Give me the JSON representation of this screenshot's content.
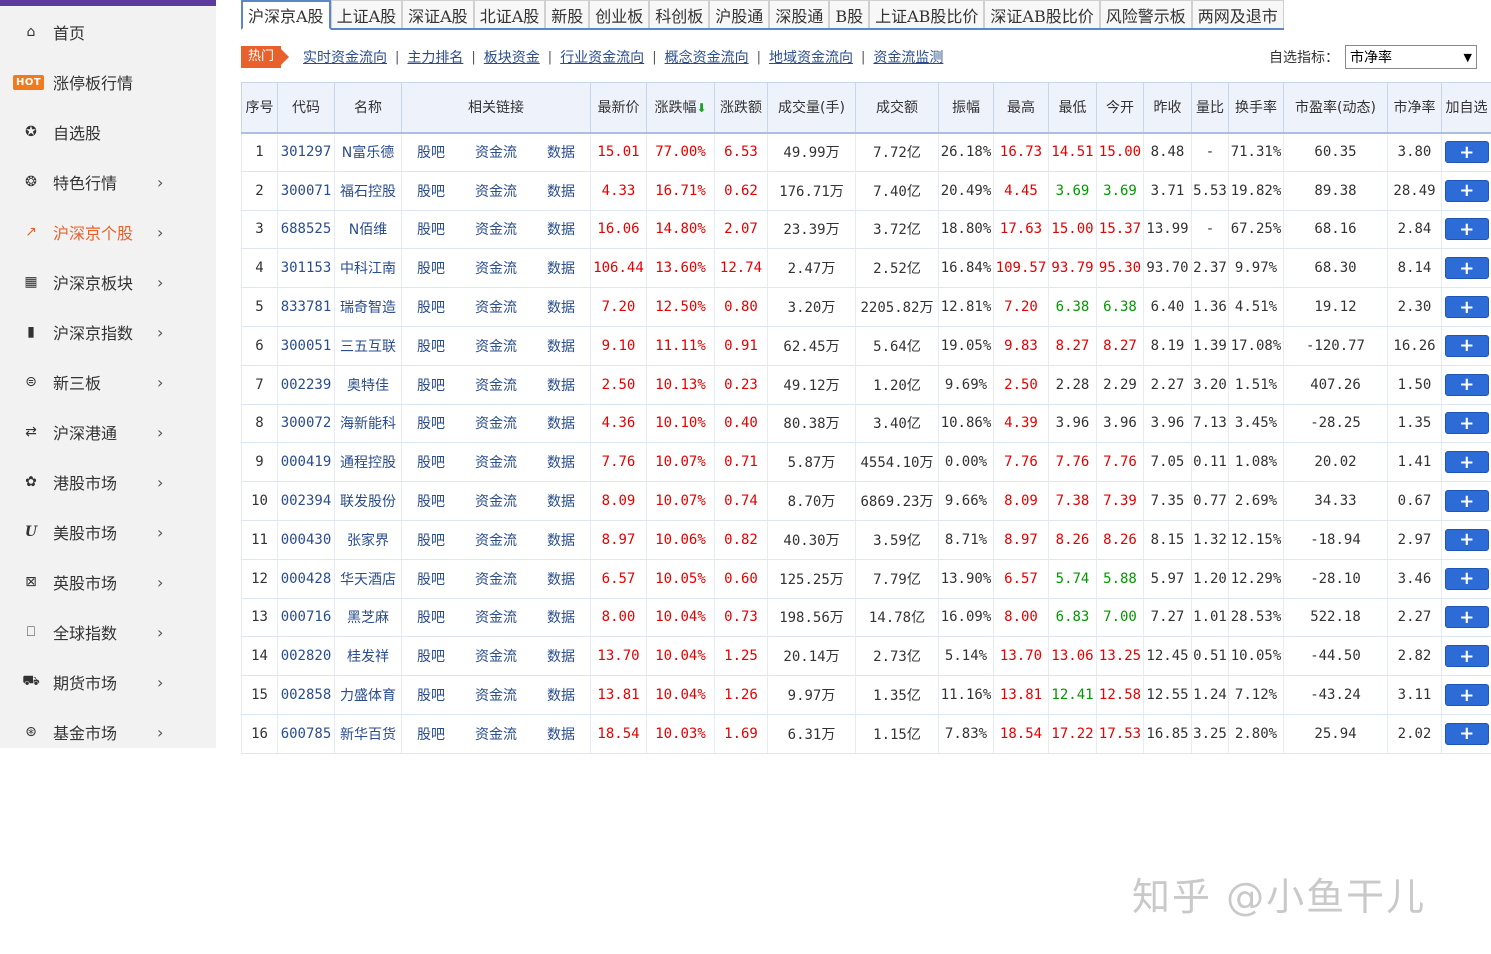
{
  "sidebar": {
    "items": [
      {
        "label": "首页",
        "icon": "home-icon",
        "glyph": "⌂",
        "chevron": false
      },
      {
        "label": "涨停板行情",
        "icon": "hot-icon",
        "glyph": "HOT",
        "chevron": false
      },
      {
        "label": "自选股",
        "icon": "star-circle-icon",
        "glyph": "✪",
        "chevron": false
      },
      {
        "label": "特色行情",
        "icon": "bulb-icon",
        "glyph": "❂",
        "chevron": true
      },
      {
        "label": "沪深京个股",
        "icon": "trend-circle-icon",
        "glyph": "↗",
        "chevron": true,
        "active": true
      },
      {
        "label": "沪深京板块",
        "icon": "grid-icon",
        "glyph": "▦",
        "chevron": true
      },
      {
        "label": "沪深京指数",
        "icon": "bar-chart-icon",
        "glyph": "▮",
        "chevron": true
      },
      {
        "label": "新三板",
        "icon": "list-circle-icon",
        "glyph": "⊜",
        "chevron": true
      },
      {
        "label": "沪深港通",
        "icon": "exchange-icon",
        "glyph": "⇄",
        "chevron": true
      },
      {
        "label": "港股市场",
        "icon": "bauhinia-icon",
        "glyph": "✿",
        "chevron": true
      },
      {
        "label": "美股市场",
        "icon": "u-letter-icon",
        "glyph": "U",
        "chevron": true
      },
      {
        "label": "英股市场",
        "icon": "uk-flag-icon",
        "glyph": "⊠",
        "chevron": true
      },
      {
        "label": "全球指数",
        "icon": "bookmark-icon",
        "glyph": "⎕",
        "chevron": true
      },
      {
        "label": "期货市场",
        "icon": "cart-icon",
        "glyph": "⛟",
        "chevron": true
      },
      {
        "label": "基金市场",
        "icon": "fund-icon",
        "glyph": "⊛",
        "chevron": true
      }
    ],
    "hot_badge": "HOT"
  },
  "tabs": [
    "沪深京A股",
    "上证A股",
    "深证A股",
    "北证A股",
    "新股",
    "创业板",
    "科创板",
    "沪股通",
    "深股通",
    "B股",
    "上证AB股比价",
    "深证AB股比价",
    "风险警示板",
    "两网及退市"
  ],
  "subnav": {
    "hot": "热门",
    "links": [
      "实时资金流向",
      "主力排名",
      "板块资金",
      "行业资金流向",
      "概念资金流向",
      "地域资金流向",
      "资金流监测"
    ],
    "separator": "|",
    "indicator_label": "自选指标：",
    "indicator_value": "市净率"
  },
  "table": {
    "headers": [
      "序号",
      "代码",
      "名称",
      "相关链接",
      "最新价",
      "涨跌幅",
      "涨跌额",
      "成交量(手)",
      "成交额",
      "振幅",
      "最高",
      "最低",
      "今开",
      "昨收",
      "量比",
      "换手率",
      "市盈率(动态)",
      "市净率",
      "加自选"
    ],
    "link_labels": [
      "股吧",
      "资金流",
      "数据"
    ],
    "add_label": "+",
    "sort_arrow": "⬇",
    "rows": [
      {
        "no": "1",
        "code": "301297",
        "name": "N富乐德",
        "price": "15.01",
        "chg_pct": "77.00%",
        "chg": "6.53",
        "vol": "49.99万",
        "amt": "7.72亿",
        "amp": "26.18%",
        "high": "16.73",
        "low": "14.51",
        "open": "15.00",
        "prev": "8.48",
        "vr": "-",
        "turn": "71.31%",
        "pe": "60.35",
        "pb": "3.80",
        "low_c": "red",
        "open_c": "red"
      },
      {
        "no": "2",
        "code": "300071",
        "name": "福石控股",
        "price": "4.33",
        "chg_pct": "16.71%",
        "chg": "0.62",
        "vol": "176.71万",
        "amt": "7.40亿",
        "amp": "20.49%",
        "high": "4.45",
        "low": "3.69",
        "open": "3.69",
        "prev": "3.71",
        "vr": "5.53",
        "turn": "19.82%",
        "pe": "89.38",
        "pb": "28.49",
        "low_c": "green",
        "open_c": "green"
      },
      {
        "no": "3",
        "code": "688525",
        "name": "N佰维",
        "price": "16.06",
        "chg_pct": "14.80%",
        "chg": "2.07",
        "vol": "23.39万",
        "amt": "3.72亿",
        "amp": "18.80%",
        "high": "17.63",
        "low": "15.00",
        "open": "15.37",
        "prev": "13.99",
        "vr": "-",
        "turn": "67.25%",
        "pe": "68.16",
        "pb": "2.84",
        "low_c": "red",
        "open_c": "red"
      },
      {
        "no": "4",
        "code": "301153",
        "name": "中科江南",
        "price": "106.44",
        "chg_pct": "13.60%",
        "chg": "12.74",
        "vol": "2.47万",
        "amt": "2.52亿",
        "amp": "16.84%",
        "high": "109.57",
        "low": "93.79",
        "open": "95.30",
        "prev": "93.70",
        "vr": "2.37",
        "turn": "9.97%",
        "pe": "68.30",
        "pb": "8.14",
        "low_c": "red",
        "open_c": "red"
      },
      {
        "no": "5",
        "code": "833781",
        "name": "瑞奇智造",
        "price": "7.20",
        "chg_pct": "12.50%",
        "chg": "0.80",
        "vol": "3.20万",
        "amt": "2205.82万",
        "amp": "12.81%",
        "high": "7.20",
        "low": "6.38",
        "open": "6.38",
        "prev": "6.40",
        "vr": "1.36",
        "turn": "4.51%",
        "pe": "19.12",
        "pb": "2.30",
        "low_c": "green",
        "open_c": "green"
      },
      {
        "no": "6",
        "code": "300051",
        "name": "三五互联",
        "price": "9.10",
        "chg_pct": "11.11%",
        "chg": "0.91",
        "vol": "62.45万",
        "amt": "5.64亿",
        "amp": "19.05%",
        "high": "9.83",
        "low": "8.27",
        "open": "8.27",
        "prev": "8.19",
        "vr": "1.39",
        "turn": "17.08%",
        "pe": "-120.77",
        "pb": "16.26",
        "low_c": "red",
        "open_c": "red"
      },
      {
        "no": "7",
        "code": "002239",
        "name": "奥特佳",
        "price": "2.50",
        "chg_pct": "10.13%",
        "chg": "0.23",
        "vol": "49.12万",
        "amt": "1.20亿",
        "amp": "9.69%",
        "high": "2.50",
        "low": "2.28",
        "open": "2.29",
        "prev": "2.27",
        "vr": "3.20",
        "turn": "1.51%",
        "pe": "407.26",
        "pb": "1.50",
        "low_c": "black",
        "open_c": "black"
      },
      {
        "no": "8",
        "code": "300072",
        "name": "海新能科",
        "price": "4.36",
        "chg_pct": "10.10%",
        "chg": "0.40",
        "vol": "80.38万",
        "amt": "3.40亿",
        "amp": "10.86%",
        "high": "4.39",
        "low": "3.96",
        "open": "3.96",
        "prev": "3.96",
        "vr": "7.13",
        "turn": "3.45%",
        "pe": "-28.25",
        "pb": "1.35",
        "low_c": "black",
        "open_c": "black"
      },
      {
        "no": "9",
        "code": "000419",
        "name": "通程控股",
        "price": "7.76",
        "chg_pct": "10.07%",
        "chg": "0.71",
        "vol": "5.87万",
        "amt": "4554.10万",
        "amp": "0.00%",
        "high": "7.76",
        "low": "7.76",
        "open": "7.76",
        "prev": "7.05",
        "vr": "0.11",
        "turn": "1.08%",
        "pe": "20.02",
        "pb": "1.41",
        "low_c": "red",
        "open_c": "red"
      },
      {
        "no": "10",
        "code": "002394",
        "name": "联发股份",
        "price": "8.09",
        "chg_pct": "10.07%",
        "chg": "0.74",
        "vol": "8.70万",
        "amt": "6869.23万",
        "amp": "9.66%",
        "high": "8.09",
        "low": "7.38",
        "open": "7.39",
        "prev": "7.35",
        "vr": "0.77",
        "turn": "2.69%",
        "pe": "34.33",
        "pb": "0.67",
        "low_c": "red",
        "open_c": "red"
      },
      {
        "no": "11",
        "code": "000430",
        "name": "张家界",
        "price": "8.97",
        "chg_pct": "10.06%",
        "chg": "0.82",
        "vol": "40.30万",
        "amt": "3.59亿",
        "amp": "8.71%",
        "high": "8.97",
        "low": "8.26",
        "open": "8.26",
        "prev": "8.15",
        "vr": "1.32",
        "turn": "12.15%",
        "pe": "-18.94",
        "pb": "2.97",
        "low_c": "red",
        "open_c": "red"
      },
      {
        "no": "12",
        "code": "000428",
        "name": "华天酒店",
        "price": "6.57",
        "chg_pct": "10.05%",
        "chg": "0.60",
        "vol": "125.25万",
        "amt": "7.79亿",
        "amp": "13.90%",
        "high": "6.57",
        "low": "5.74",
        "open": "5.88",
        "prev": "5.97",
        "vr": "1.20",
        "turn": "12.29%",
        "pe": "-28.10",
        "pb": "3.46",
        "low_c": "green",
        "open_c": "green"
      },
      {
        "no": "13",
        "code": "000716",
        "name": "黑芝麻",
        "price": "8.00",
        "chg_pct": "10.04%",
        "chg": "0.73",
        "vol": "198.56万",
        "amt": "14.78亿",
        "amp": "16.09%",
        "high": "8.00",
        "low": "6.83",
        "open": "7.00",
        "prev": "7.27",
        "vr": "1.01",
        "turn": "28.53%",
        "pe": "522.18",
        "pb": "2.27",
        "low_c": "green",
        "open_c": "green"
      },
      {
        "no": "14",
        "code": "002820",
        "name": "桂发祥",
        "price": "13.70",
        "chg_pct": "10.04%",
        "chg": "1.25",
        "vol": "20.14万",
        "amt": "2.73亿",
        "amp": "5.14%",
        "high": "13.70",
        "low": "13.06",
        "open": "13.25",
        "prev": "12.45",
        "vr": "0.51",
        "turn": "10.05%",
        "pe": "-44.50",
        "pb": "2.82",
        "low_c": "red",
        "open_c": "red"
      },
      {
        "no": "15",
        "code": "002858",
        "name": "力盛体育",
        "price": "13.81",
        "chg_pct": "10.04%",
        "chg": "1.26",
        "vol": "9.97万",
        "amt": "1.35亿",
        "amp": "11.16%",
        "high": "13.81",
        "low": "12.41",
        "open": "12.58",
        "prev": "12.55",
        "vr": "1.24",
        "turn": "7.12%",
        "pe": "-43.24",
        "pb": "3.11",
        "low_c": "green",
        "open_c": "red"
      },
      {
        "no": "16",
        "code": "600785",
        "name": "新华百货",
        "price": "18.54",
        "chg_pct": "10.03%",
        "chg": "1.69",
        "vol": "6.31万",
        "amt": "1.15亿",
        "amp": "7.83%",
        "high": "18.54",
        "low": "17.22",
        "open": "17.53",
        "prev": "16.85",
        "vr": "3.25",
        "turn": "2.80%",
        "pe": "25.94",
        "pb": "2.02",
        "low_c": "red",
        "open_c": "red"
      }
    ]
  },
  "watermark": "知乎 @小鱼干儿",
  "colors": {
    "up": "#e60000",
    "down": "#009900",
    "accent": "#e8612c",
    "link": "#2a4d8f",
    "button": "#2d6bd6"
  }
}
